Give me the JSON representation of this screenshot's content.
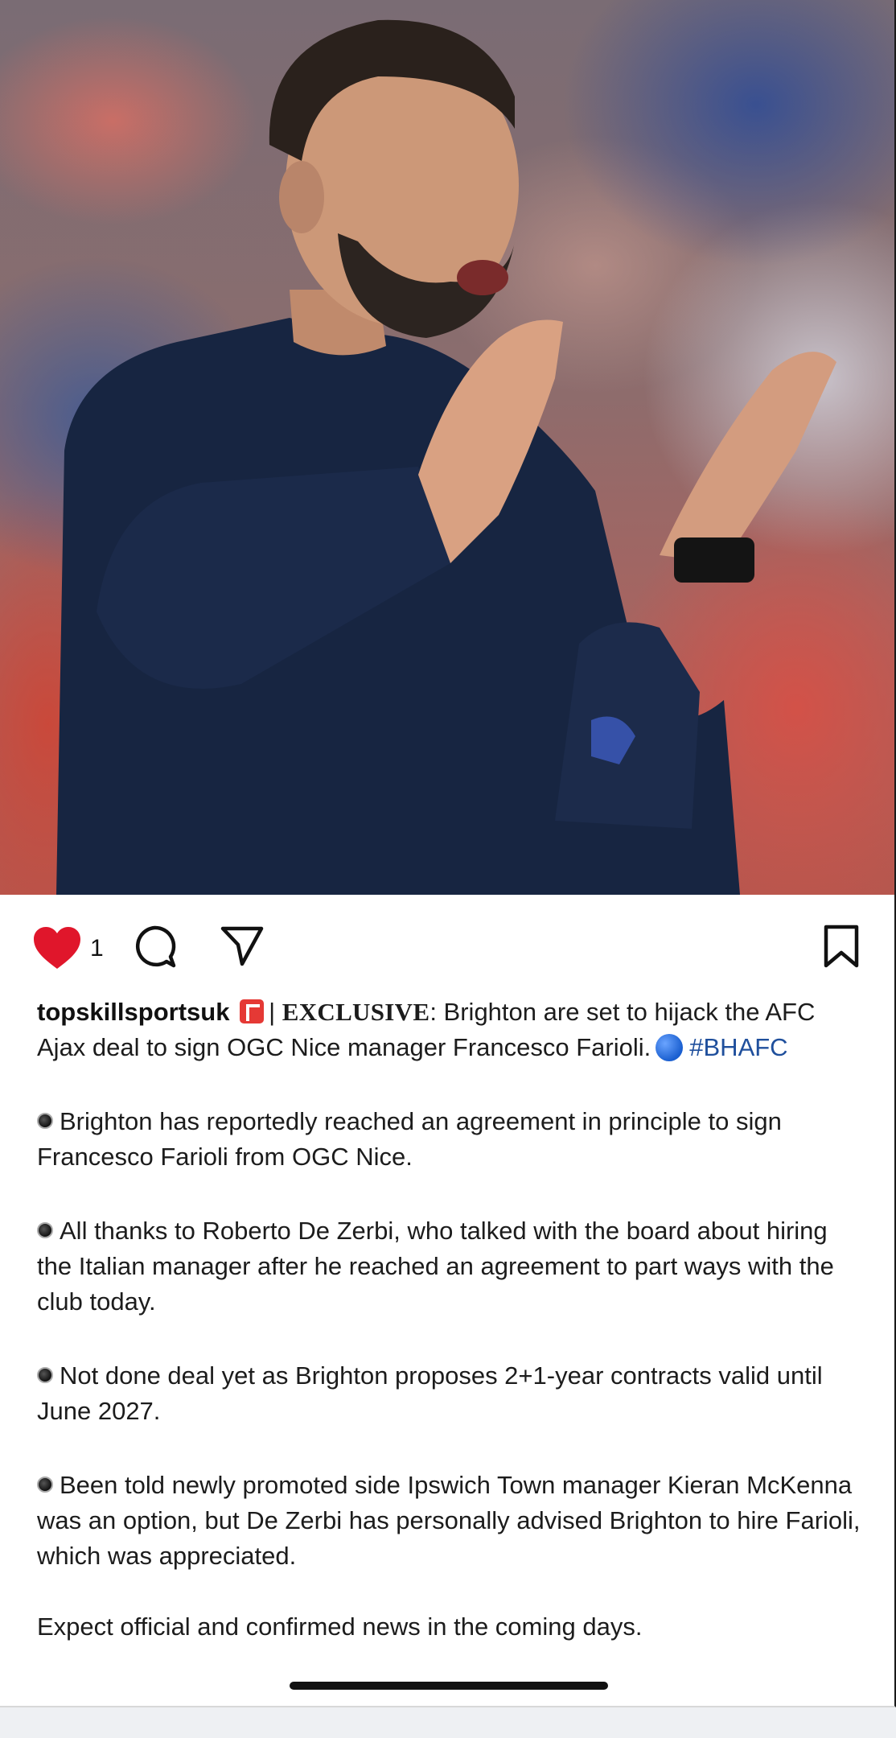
{
  "post": {
    "likes_count": "1",
    "username": "topskillsportsuk",
    "caption_lead": "| ",
    "caption_exclusive": "EXCLUSIVE",
    "caption_intro": ": Brighton are set to hijack the AFC Ajax deal to sign OGC Nice manager Francesco Farioli.",
    "hashtag": "#BHAFC",
    "bullets": [
      "Brighton has reportedly reached an agreement in principle to sign Francesco Farioli from OGC Nice.",
      "All thanks to Roberto De Zerbi, who talked with the board about hiring the Italian manager after he reached an agreement to part ways with the club today.",
      "Not done deal yet as Brighton proposes 2+1-year contracts valid until June 2027.",
      "Been told newly promoted side Ipswich Town manager Kieran McKenna was an option, but De Zerbi has personally advised Brighton to hire Farioli, which was appreciated."
    ],
    "closing": "Expect official and confirmed news in the coming days."
  },
  "icons": {
    "heart": "heart-icon",
    "comment": "comment-icon",
    "share": "send-icon",
    "bookmark": "bookmark-icon",
    "flag": "flag-emoji",
    "blue_circle": "blue-circle-emoji",
    "bullet": "black-circle-bullet"
  },
  "colors": {
    "like_red": "#e0162b",
    "hashtag_blue": "#1f4f9c",
    "sweater_navy": "#162440"
  }
}
